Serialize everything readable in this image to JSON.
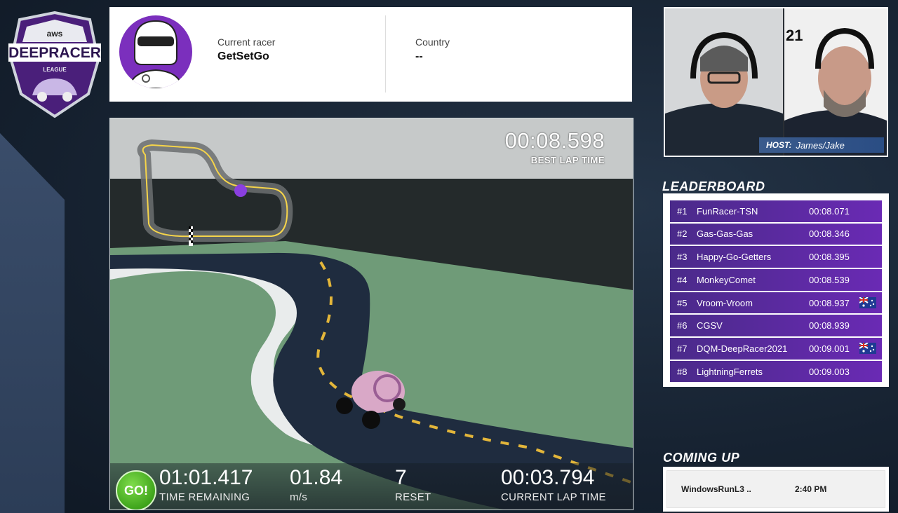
{
  "logo": {
    "brand": "aws",
    "name": "DEEPRACER",
    "sub": "LEAGUE"
  },
  "racer": {
    "current_racer_label": "Current racer",
    "current_racer": "GetSetGo",
    "country_label": "Country",
    "country": "--"
  },
  "track": {
    "best_lap_time": "00:08.598",
    "best_lap_label": "BEST LAP TIME"
  },
  "hud": {
    "go_label": "GO!",
    "time_remaining": "01:01.417",
    "time_remaining_label": "TIME REMAINING",
    "speed": "01.84",
    "speed_label": "m/s",
    "resets": "7",
    "resets_label": "RESET",
    "current_lap_time": "00:03.794",
    "current_lap_label": "CURRENT LAP TIME"
  },
  "host": {
    "badge": "21",
    "caption_label": "HOST:",
    "caption_names": "James/Jake"
  },
  "leaderboard": {
    "title": "LEADERBOARD",
    "rows": [
      {
        "rank": "#1",
        "name": "FunRacer-TSN",
        "time": "00:08.071",
        "flag": ""
      },
      {
        "rank": "#2",
        "name": "Gas-Gas-Gas",
        "time": "00:08.346",
        "flag": ""
      },
      {
        "rank": "#3",
        "name": "Happy-Go-Getters",
        "time": "00:08.395",
        "flag": ""
      },
      {
        "rank": "#4",
        "name": "MonkeyComet",
        "time": "00:08.539",
        "flag": ""
      },
      {
        "rank": "#5",
        "name": "Vroom-Vroom",
        "time": "00:08.937",
        "flag": "au-flag-icon"
      },
      {
        "rank": "#6",
        "name": "CGSV",
        "time": "00:08.939",
        "flag": ""
      },
      {
        "rank": "#7",
        "name": "DQM-DeepRacer2021",
        "time": "00:09.001",
        "flag": "au-flag-icon"
      },
      {
        "rank": "#8",
        "name": "LightningFerrets",
        "time": "00:09.003",
        "flag": ""
      }
    ]
  },
  "coming_up": {
    "title": "COMING UP",
    "racer": "WindowsRunL3 ..",
    "time": "2:40 PM"
  },
  "colors": {
    "accent_purple": "#6a2ab4",
    "go_green": "#3fa51c",
    "track_grass": "#6f9b78"
  }
}
